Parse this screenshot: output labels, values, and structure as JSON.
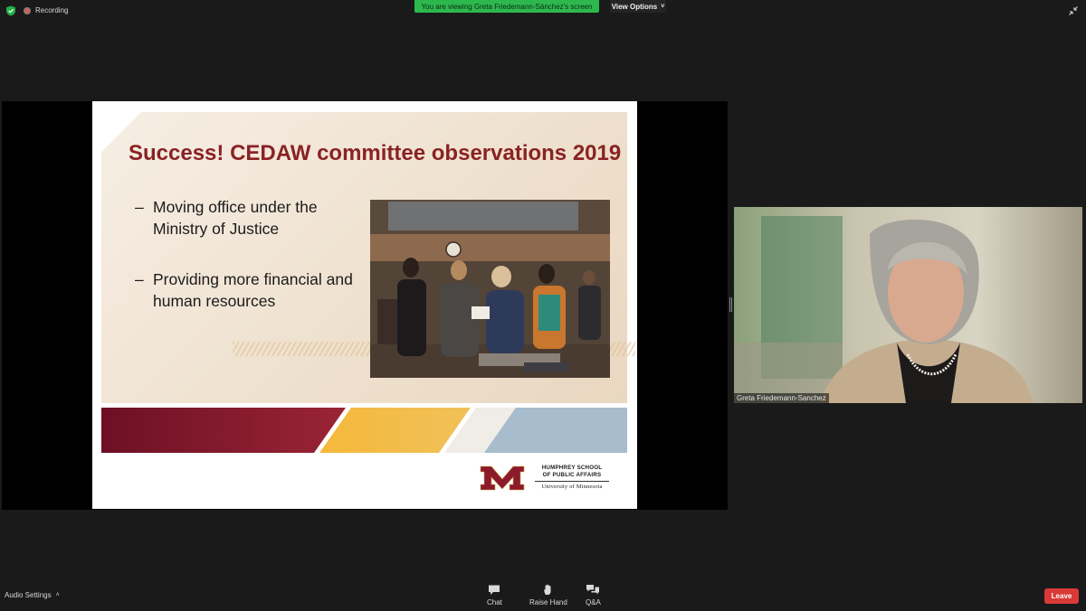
{
  "top_bar": {
    "recording_label": "Recording",
    "banner_text": "You are viewing Greta Friedemann-Sánchez's screen",
    "view_options_label": "View Options",
    "icons": [
      "shield-check-icon",
      "record-icon",
      "chevron-down-icon",
      "exit-fullscreen-icon"
    ]
  },
  "slide": {
    "title": "Success! CEDAW committee observations 2019",
    "bullets": [
      {
        "dash": "–",
        "line1": "Moving office under the",
        "line2": "Ministry of Justice"
      },
      {
        "dash": "–",
        "line1": "Providing more financial and",
        "line2": "human resources"
      }
    ],
    "logo": {
      "line1": "HUMPHREY SCHOOL",
      "line2": "OF PUBLIC AFFAIRS",
      "line3": "University of Minnesota"
    },
    "colors": {
      "title": "#8a2224",
      "maroon": "#7a1526",
      "gold": "#f2b23c",
      "slate": "#a9bdcf"
    }
  },
  "video": {
    "participant_name": "Greta Friedemann-Sanchez"
  },
  "toolbar": {
    "audio_settings_label": "Audio Settings",
    "chat_label": "Chat",
    "raise_hand_label": "Raise Hand",
    "qa_label": "Q&A",
    "leave_label": "Leave",
    "leave_color": "#d93a38"
  }
}
